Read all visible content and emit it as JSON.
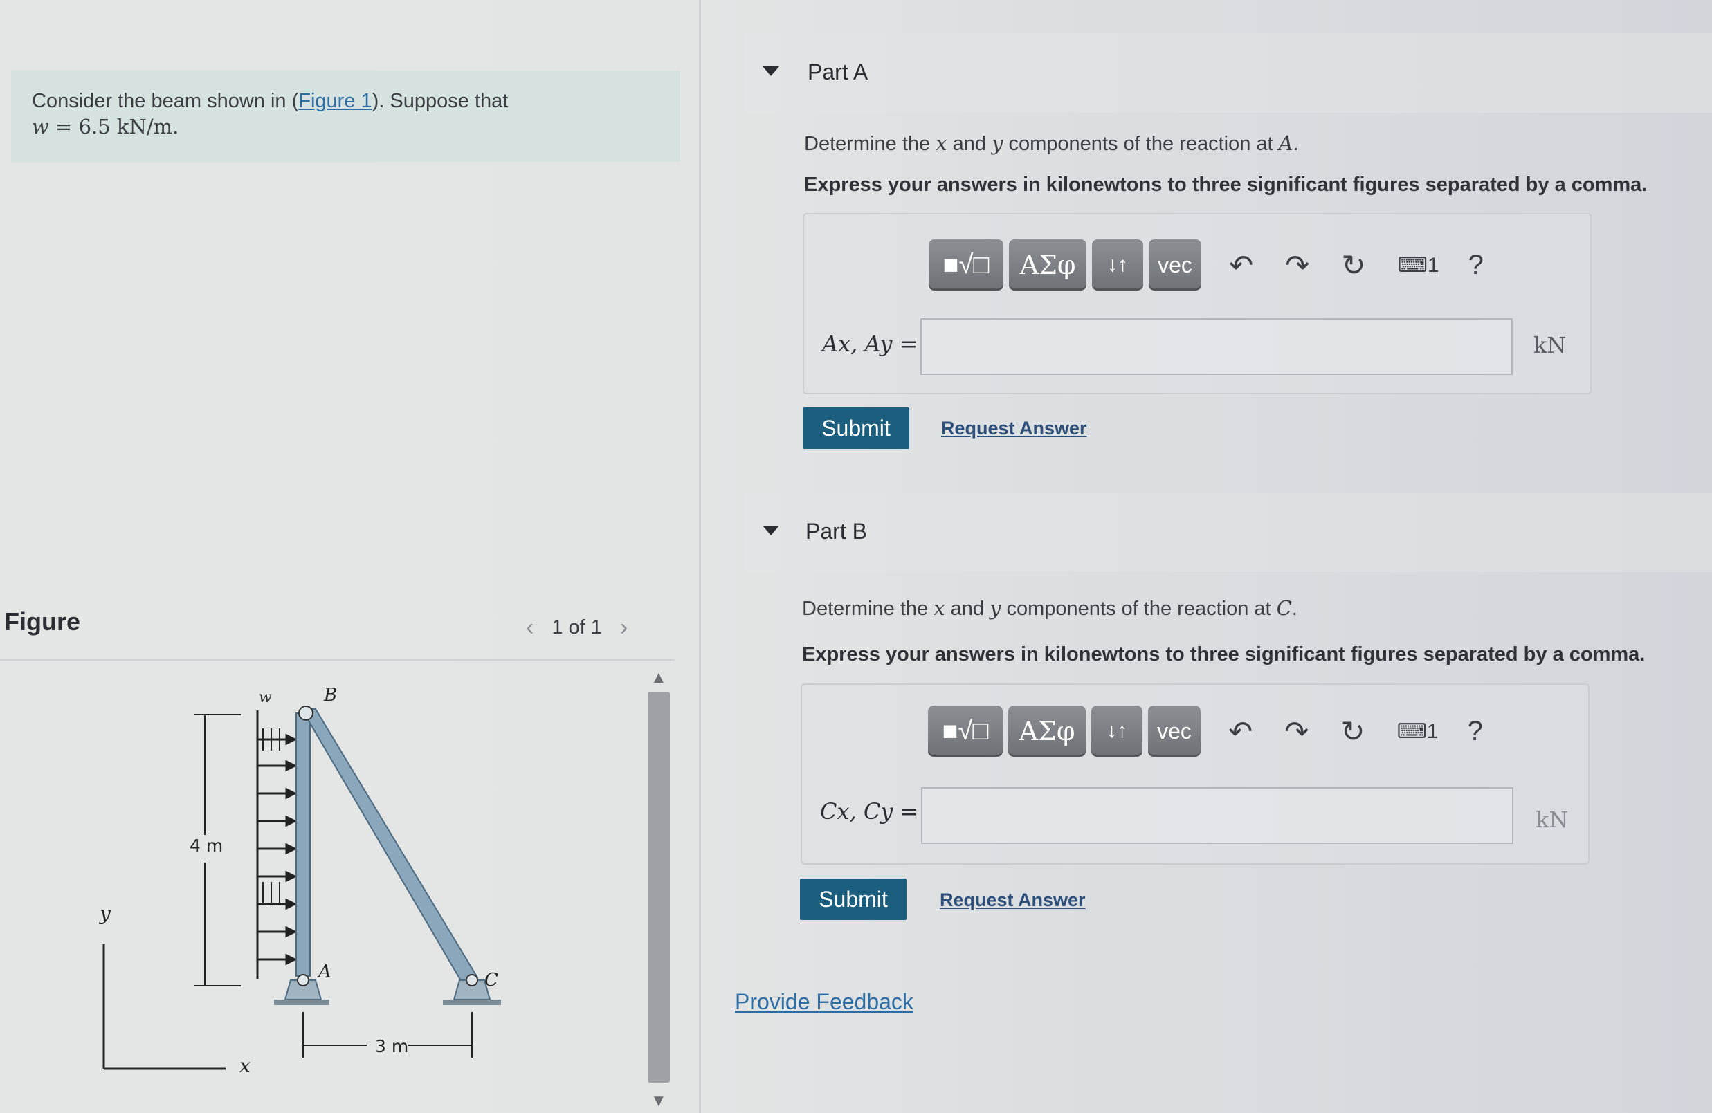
{
  "problem": {
    "text_before_link": "Consider the beam shown in (",
    "link": "Figure 1",
    "text_after_link": "). Suppose that",
    "given_var": "w",
    "given_value": " = 6.5 kN/m."
  },
  "figure": {
    "title": "Figure",
    "pager": "1 of 1",
    "labels": {
      "w": "w",
      "B": "B",
      "A": "A",
      "C": "C",
      "height": "4 m",
      "span": "3 m",
      "y_axis": "y",
      "x_axis": "x"
    }
  },
  "part_a": {
    "title": "Part A",
    "prompt_1": "Determine the ",
    "prompt_x": "x",
    "prompt_2": " and ",
    "prompt_y": "y",
    "prompt_3": " components of the reaction at ",
    "prompt_point": "A",
    "prompt_end": ".",
    "instructions": "Express your answers in kilonewtons to three significant figures separated by a comma.",
    "answer_label": "Ax, Ay =",
    "answer_value": "",
    "unit": "kN",
    "submit": "Submit",
    "request": "Request Answer"
  },
  "part_b": {
    "title": "Part B",
    "prompt_1": "Determine the ",
    "prompt_x": "x",
    "prompt_2": " and ",
    "prompt_y": "y",
    "prompt_3": " components of the reaction at ",
    "prompt_point": "C",
    "prompt_end": ".",
    "instructions": "Express your answers in kilonewtons to three significant figures separated by a comma.",
    "answer_label": "Cx, Cy =",
    "answer_value": "",
    "unit": "kN",
    "submit": "Submit",
    "request": "Request Answer"
  },
  "toolbar": {
    "greek": "ΑΣφ",
    "vec": "vec",
    "arrows": "↓↑",
    "keyboard_suffix": "1",
    "help": "?",
    "icons": [
      "templates-icon",
      "greek-icon",
      "subscript-icon",
      "vector-icon",
      "undo-icon",
      "redo-icon",
      "reset-icon",
      "keyboard-icon",
      "help-icon"
    ]
  },
  "feedback": "Provide Feedback"
}
